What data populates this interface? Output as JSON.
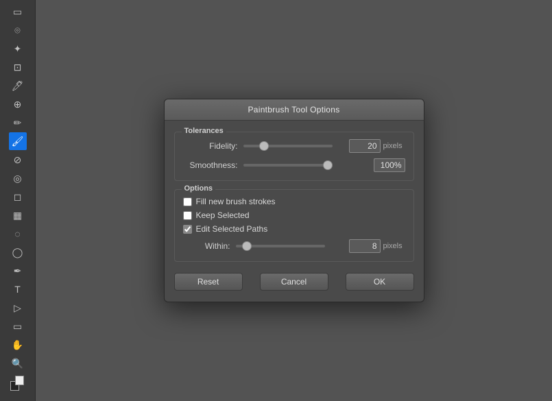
{
  "toolbar": {
    "tools": [
      {
        "name": "marquee",
        "icon": "▭"
      },
      {
        "name": "lasso",
        "icon": "⌖"
      },
      {
        "name": "quick-selection",
        "icon": "✦"
      },
      {
        "name": "crop",
        "icon": "⊡"
      },
      {
        "name": "eyedropper",
        "icon": "🖊"
      },
      {
        "name": "healing",
        "icon": "⊕"
      },
      {
        "name": "brush",
        "icon": "✏"
      },
      {
        "name": "clone",
        "icon": "⊘"
      },
      {
        "name": "history",
        "icon": "◎"
      },
      {
        "name": "eraser",
        "icon": "▭"
      },
      {
        "name": "gradient",
        "icon": "▦"
      },
      {
        "name": "blur",
        "icon": "◌"
      },
      {
        "name": "dodge",
        "icon": "◯"
      },
      {
        "name": "pen",
        "icon": "✒"
      },
      {
        "name": "text",
        "icon": "T"
      },
      {
        "name": "path-select",
        "icon": "⊳"
      },
      {
        "name": "shape",
        "icon": "▭"
      },
      {
        "name": "hand",
        "icon": "☜"
      },
      {
        "name": "zoom",
        "icon": "⊕"
      },
      {
        "name": "foreground",
        "icon": "■"
      },
      {
        "name": "background",
        "icon": "□"
      }
    ]
  },
  "dialog": {
    "title": "Paintbrush Tool Options",
    "sections": {
      "tolerances": {
        "label": "Tolerances",
        "fidelity": {
          "label": "Fidelity:",
          "value": "20",
          "unit": "pixels",
          "min": 0,
          "max": 100,
          "current": 20
        },
        "smoothness": {
          "label": "Smoothness:",
          "value": "100%",
          "min": 0,
          "max": 100,
          "current": 100
        }
      },
      "options": {
        "label": "Options",
        "fill_new_brush_strokes": {
          "label": "Fill new brush strokes",
          "checked": false
        },
        "keep_selected": {
          "label": "Keep Selected",
          "checked": false
        },
        "edit_selected_paths": {
          "label": "Edit Selected Paths",
          "checked": true
        },
        "within": {
          "label": "Within:",
          "value": "8",
          "unit": "pixels",
          "min": 0,
          "max": 100,
          "current": 8
        }
      }
    },
    "buttons": {
      "reset": "Reset",
      "cancel": "Cancel",
      "ok": "OK"
    }
  }
}
